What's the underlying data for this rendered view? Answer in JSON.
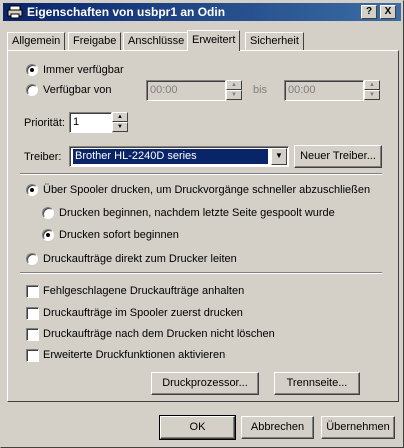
{
  "window": {
    "title": "Eigenschaften von usbpr1 an Odin",
    "help_btn": "?",
    "close_btn": "X"
  },
  "tabs": [
    {
      "label": "Allgemein",
      "active": false
    },
    {
      "label": "Freigabe",
      "active": false
    },
    {
      "label": "Anschlüsse",
      "active": false
    },
    {
      "label": "Erweitert",
      "active": true
    },
    {
      "label": "Sicherheit",
      "active": false
    }
  ],
  "availability": {
    "always_label": "Immer verfügbar",
    "from_label": "Verfügbar von",
    "from_time": "00:00",
    "to_label": "bis",
    "to_time": "00:00"
  },
  "priority": {
    "label": "Priorität:",
    "value": "1"
  },
  "driver": {
    "label": "Treiber:",
    "value": "Brother HL-2240D series",
    "new_button": "Neuer Treiber..."
  },
  "spooling": {
    "spool_label": "Über Spooler drucken, um Druckvorgänge schneller abzuschließen",
    "after_last_page_label": "Drucken beginnen, nachdem letzte Seite gespoolt wurde",
    "immediately_label": "Drucken sofort beginnen",
    "direct_label": "Druckaufträge direkt zum Drucker leiten"
  },
  "options": [
    {
      "label": "Fehlgeschlagene Druckaufträge anhalten",
      "checked": false
    },
    {
      "label": "Druckaufträge im Spooler zuerst drucken",
      "checked": false
    },
    {
      "label": "Druckaufträge nach dem Drucken nicht löschen",
      "checked": false
    },
    {
      "label": "Erweiterte Druckfunktionen aktivieren",
      "checked": false
    }
  ],
  "panel_buttons": {
    "processor": "Druckprozessor...",
    "separator": "Trennseite..."
  },
  "footer": {
    "ok": "OK",
    "cancel": "Abbrechen",
    "apply": "Übernehmen"
  }
}
